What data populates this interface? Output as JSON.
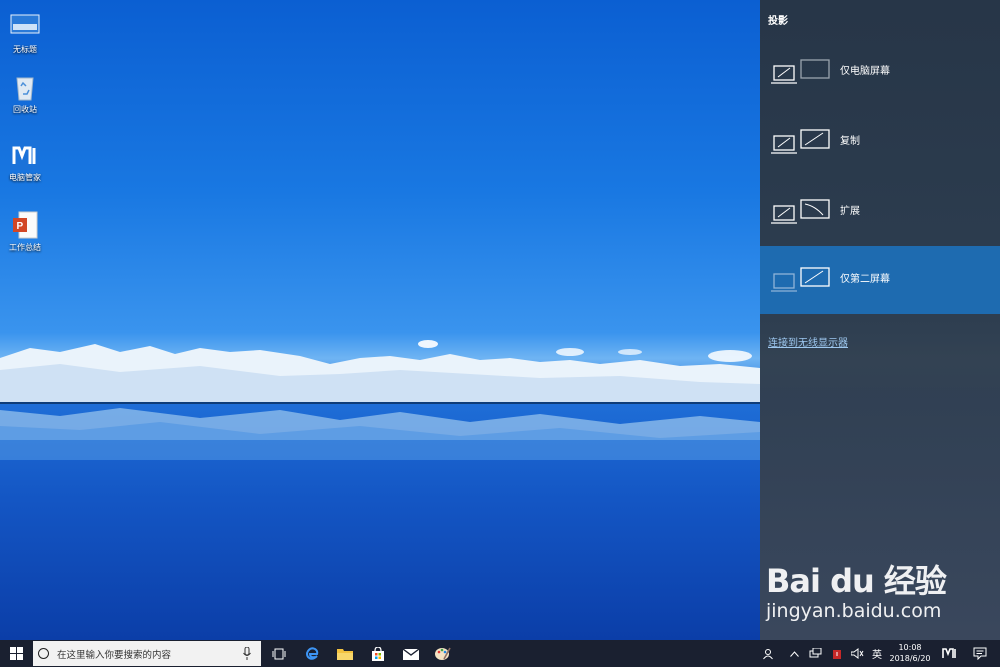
{
  "desktop": {
    "icons": [
      {
        "label": "无标题",
        "icon": "image-file-icon"
      },
      {
        "label": "回收站",
        "icon": "recycle-bin-icon"
      },
      {
        "label": "电脑管家",
        "icon": "pc-manager-icon"
      },
      {
        "label": "工作总结",
        "icon": "powerpoint-file-icon"
      }
    ]
  },
  "project_panel": {
    "title": "投影",
    "options": [
      {
        "label": "仅电脑屏幕",
        "selected": false
      },
      {
        "label": "复制",
        "selected": false
      },
      {
        "label": "扩展",
        "selected": false
      },
      {
        "label": "仅第二屏幕",
        "selected": true
      }
    ],
    "wireless_link": "连接到无线显示器",
    "accent": "#1e6bb0"
  },
  "taskbar": {
    "search_placeholder": "在这里输入你要搜索的内容",
    "apps": [
      "task-view-icon",
      "edge-icon",
      "file-explorer-icon",
      "store-icon",
      "mail-icon",
      "paint-icon"
    ],
    "tray": {
      "language": "英",
      "time": "10:08",
      "date": "2018/6/20"
    }
  },
  "watermark": {
    "logo": "Bai du 经验",
    "url": "jingyan.baidu.com"
  }
}
